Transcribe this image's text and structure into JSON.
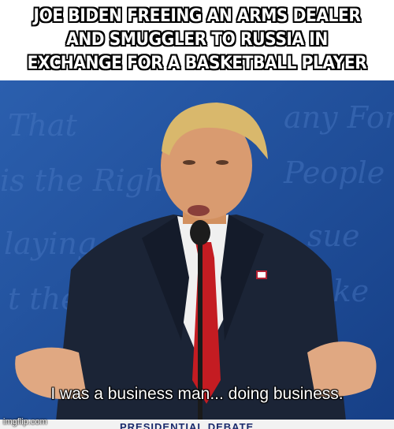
{
  "top_caption": "JOE BIDEN FREEING AN ARMS DEALER AND SMUGGLER TO RUSSIA IN EXCHANGE FOR A BASKETBALL PLAYER",
  "subtitle": "I was a business man... doing business.",
  "banner": "PRESIDENTIAL DEBATE",
  "watermark": "imgflip.com",
  "colors": {
    "backdrop_blue": "#1f4f9a",
    "suit": "#1b2436",
    "tie": "#c41c22",
    "shirt": "#f2f2f2",
    "skin": "#d99b70",
    "hair": "#d9b86c"
  },
  "icons": [
    "flag-pin-icon",
    "microphone-icon"
  ]
}
